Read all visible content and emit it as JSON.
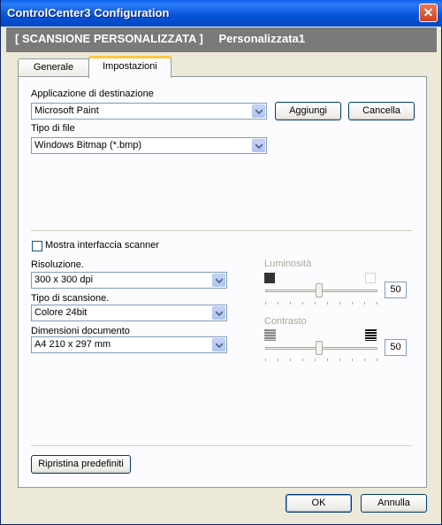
{
  "window": {
    "title": "ControlCenter3 Configuration"
  },
  "header": {
    "section": "[ SCANSIONE PERSONALIZZATA ]",
    "profile": "Personalizzata1"
  },
  "tabs": [
    {
      "label": "Generale"
    },
    {
      "label": "Impostazioni"
    }
  ],
  "destination": {
    "label": "Applicazione di destinazione",
    "value": "Microsoft Paint",
    "add_label": "Aggiungi",
    "delete_label": "Cancella"
  },
  "file_type": {
    "label": "Tipo di file",
    "value": "Windows Bitmap (*.bmp)"
  },
  "scanner_ui": {
    "label": "Mostra interfaccia scanner",
    "checked": false
  },
  "resolution": {
    "label": "Risoluzione.",
    "value": "300 x 300 dpi"
  },
  "scan_type": {
    "label": "Tipo di scansione.",
    "value": "Colore 24bit"
  },
  "document_size": {
    "label": "Dimensioni documento",
    "value": "A4 210 x 297 mm"
  },
  "brightness": {
    "label": "Luminosità",
    "value": "50"
  },
  "contrast": {
    "label": "Contrasto",
    "value": "50"
  },
  "restore_defaults_label": "Ripristina predefiniti",
  "ok_label": "OK",
  "cancel_label": "Annulla",
  "icons": {
    "close": "close-icon",
    "dropdown": "chevron-down-icon",
    "brightness_low": "dark-square-icon",
    "brightness_high": "light-square-icon",
    "contrast_low": "low-contrast-icon",
    "contrast_high": "high-contrast-icon"
  },
  "colors": {
    "titlebar": "#0553D8",
    "header": "#7A7A7A",
    "tab_highlight": "#FFC83C"
  }
}
